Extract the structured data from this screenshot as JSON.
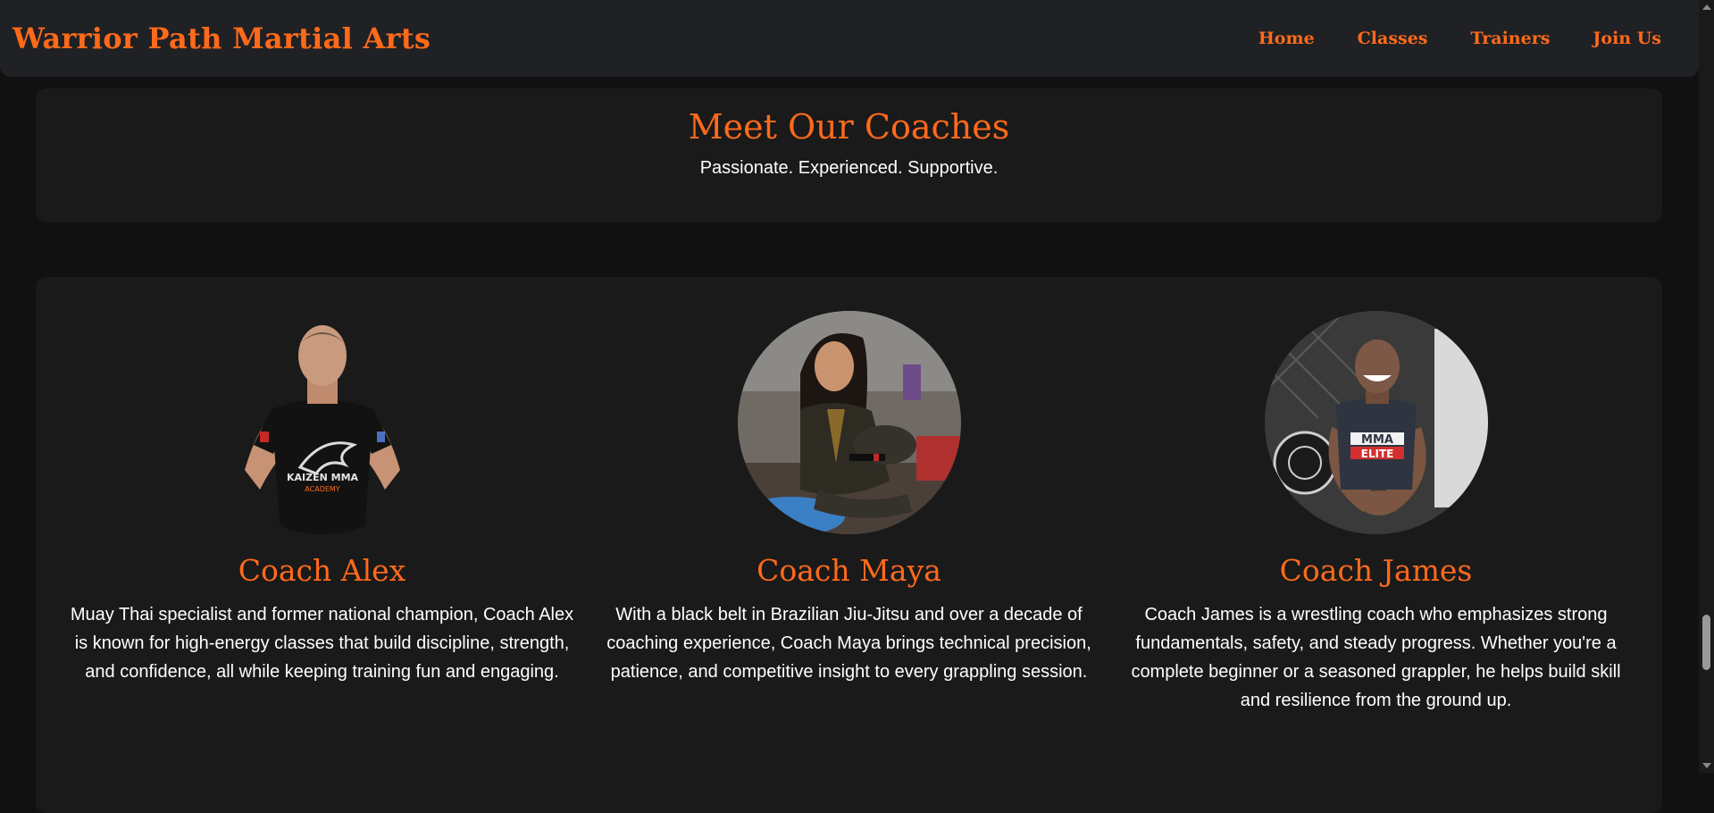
{
  "navbar": {
    "brand": "Warrior Path Martial Arts",
    "links": [
      {
        "label": "Home"
      },
      {
        "label": "Classes"
      },
      {
        "label": "Trainers"
      },
      {
        "label": "Join Us"
      }
    ]
  },
  "header": {
    "title": "Meet Our Coaches",
    "subtitle": "Passionate. Experienced. Supportive."
  },
  "coaches": [
    {
      "name": "Coach Alex",
      "bio": "Muay Thai specialist and former national champion, Coach Alex is known for high-energy classes that build discipline, strength, and confidence, all while keeping training fun and engaging.",
      "shirt_text": "KAIZEN MMA",
      "shirt_subtext": "ACADEMY"
    },
    {
      "name": "Coach Maya",
      "bio": "With a black belt in Brazilian Jiu-Jitsu and over a decade of coaching experience, Coach Maya brings technical precision, patience, and competitive insight to every grappling session."
    },
    {
      "name": "Coach James",
      "bio": "Coach James is a wrestling coach who emphasizes strong fundamentals, safety, and steady progress. Whether you're a complete beginner or a seasoned grappler, he helps build skill and resilience from the ground up.",
      "shirt_text": "MMA",
      "shirt_subtext": "ELITE"
    }
  ],
  "colors": {
    "accent": "#ff6a1a",
    "background": "#111111",
    "panel": "#1a1a1a",
    "navbar": "#1f2124"
  }
}
